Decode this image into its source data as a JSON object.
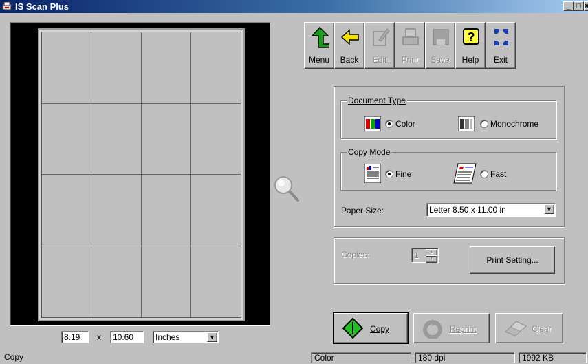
{
  "window": {
    "title": "IS Scan Plus",
    "min": "_",
    "max": "□",
    "close": "×"
  },
  "toolbar": [
    {
      "label": "Menu",
      "enabled": true,
      "icon": "green-up-arrow-icon"
    },
    {
      "label": "Back",
      "enabled": true,
      "icon": "yellow-left-arrow-icon"
    },
    {
      "label": "Edit",
      "enabled": false,
      "icon": "edit-icon"
    },
    {
      "label": "Print",
      "enabled": false,
      "icon": "printer-icon"
    },
    {
      "label": "Save",
      "enabled": false,
      "icon": "floppy-disk-icon"
    },
    {
      "label": "Help",
      "enabled": true,
      "icon": "help-question-icon"
    },
    {
      "label": "Exit",
      "enabled": true,
      "icon": "exit-icon"
    }
  ],
  "document_type": {
    "legend": "Document Type",
    "options": [
      {
        "label": "Color",
        "selected": true
      },
      {
        "label": "Monochrome",
        "selected": false
      }
    ]
  },
  "copy_mode": {
    "legend": "Copy Mode",
    "options": [
      {
        "label": "Fine",
        "selected": true
      },
      {
        "label": "Fast",
        "selected": false
      }
    ]
  },
  "paper_size": {
    "label": "Paper Size:",
    "value": "Letter 8.50 x 11.00 in"
  },
  "copies": {
    "label": "Copies:",
    "value": "1",
    "enabled": false
  },
  "buttons": {
    "print_setting": "Print Setting...",
    "copy": "Copy",
    "reprint": "Reprint",
    "clear": "Clear"
  },
  "dimensions": {
    "width": "8.19",
    "separator": "x",
    "height": "10.60",
    "units": "Inches"
  },
  "status": {
    "mode": "Copy",
    "color": "Color",
    "dpi": "180 dpi",
    "size": "1992 KB"
  },
  "colors": {
    "title_start": "#0a246a",
    "title_end": "#a6caf0",
    "face": "#c0c0c0",
    "disabled": "#8a8a8a"
  }
}
